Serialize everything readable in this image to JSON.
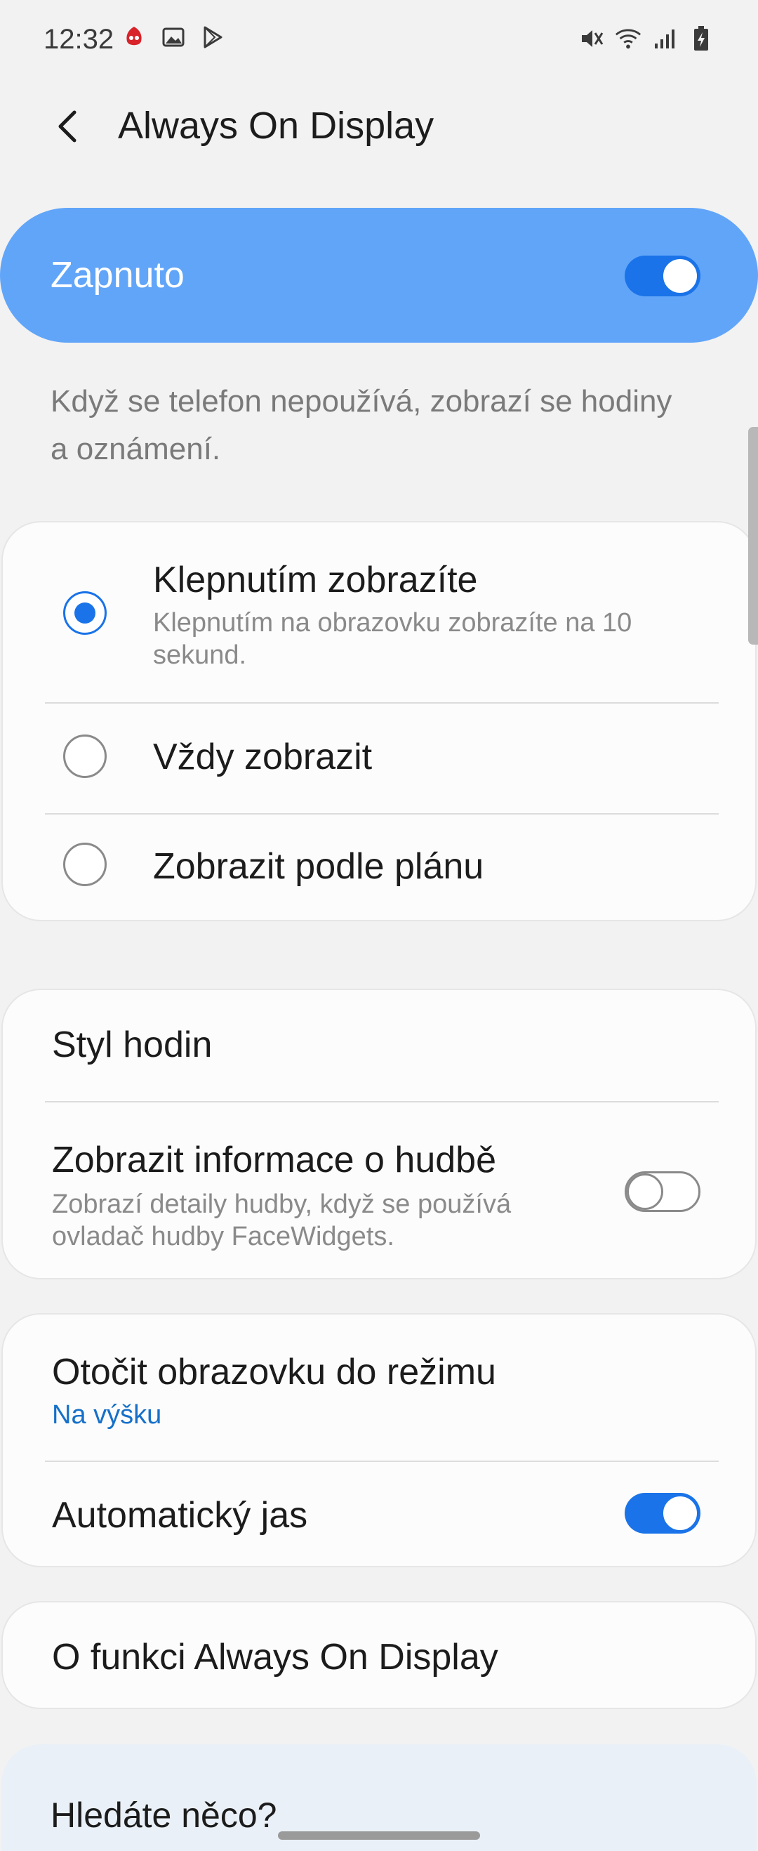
{
  "status_bar": {
    "time": "12:32",
    "left_icons": [
      "antutu-icon",
      "gallery-icon",
      "play-store-icon"
    ],
    "right_icons": [
      "mute-icon",
      "wifi-icon",
      "signal-icon",
      "battery-charging-icon"
    ]
  },
  "header": {
    "title": "Always On Display"
  },
  "master_switch": {
    "label": "Zapnuto",
    "enabled": true
  },
  "description": "Když se telefon nepoužívá, zobrazí se hodiny a oznámení.",
  "display_mode": {
    "options": [
      {
        "label": "Klepnutím zobrazíte",
        "subtitle": "Klepnutím na obrazovku zobrazíte na 10 sekund.",
        "selected": true
      },
      {
        "label": "Vždy zobrazit",
        "selected": false
      },
      {
        "label": "Zobrazit podle plánu",
        "selected": false
      }
    ]
  },
  "style_section": {
    "clock_style": "Styl hodin",
    "music_info": {
      "label": "Zobrazit informace o hudbě",
      "subtitle": "Zobrazí detaily hudby, když se používá ovladač hudby FaceWidgets.",
      "enabled": false
    }
  },
  "orientation_section": {
    "rotate": {
      "label": "Otočit obrazovku do režimu",
      "value": "Na výšku"
    },
    "auto_brightness": {
      "label": "Automatický jas",
      "enabled": true
    }
  },
  "about": {
    "label": "O funkci Always On Display"
  },
  "suggestions": {
    "title": "Hledáte něco?"
  },
  "colors": {
    "accent": "#1a73e8",
    "master_background": "#61a5f9",
    "link": "#1670c9"
  }
}
